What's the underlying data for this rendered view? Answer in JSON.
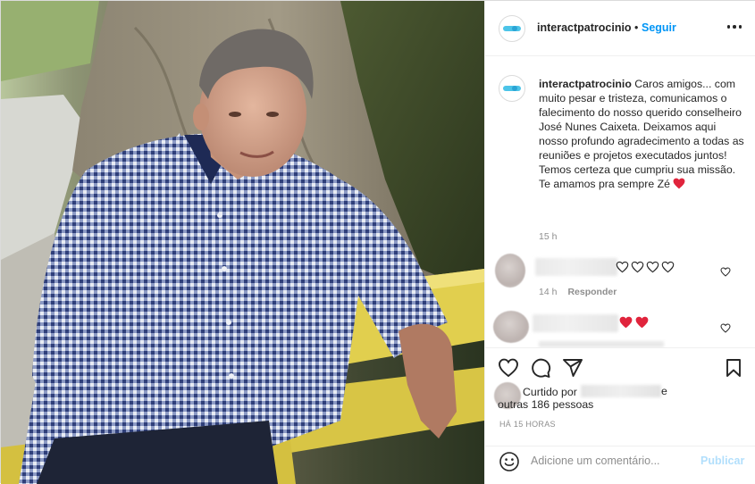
{
  "post": {
    "username": "interactpatrocinio",
    "separator": "•",
    "follow_label": "Seguir",
    "more_icon": "more-icon"
  },
  "caption": {
    "username": "interactpatrocinio",
    "text": "Caros amigos... com muito pesar e tristeza, comunicamos o falecimento do nosso querido conselheiro José Nunes Caixeta. Deixamos aqui nosso profundo agradecimento a todas as reuniões e projetos executados juntos! Temos certeza que cumpriu sua missão. Te amamos pra sempre Zé",
    "time": "15 h",
    "emoji": "red-heart"
  },
  "comments": [
    {
      "time": "14 h",
      "reply_label": "Responder",
      "emoji": [
        "white-heart",
        "white-heart",
        "white-heart",
        "white-heart"
      ]
    },
    {
      "emoji": [
        "red-heart",
        "red-heart"
      ]
    }
  ],
  "actions": {
    "like_icon": "heart-icon",
    "comment_icon": "comment-icon",
    "share_icon": "share-icon",
    "save_icon": "bookmark-icon"
  },
  "likes": {
    "prefix": "Curtido por",
    "suffix": "e",
    "others": "outras 186 pessoas"
  },
  "timestamp": "HÁ 15 HORAS",
  "add_comment": {
    "placeholder": "Adicione um comentário...",
    "publish_label": "Publicar"
  },
  "colors": {
    "link": "#0095f6",
    "publish_disabled": "#b2dffc",
    "heart_red": "#ed4956",
    "muted": "#8e8e8e"
  }
}
